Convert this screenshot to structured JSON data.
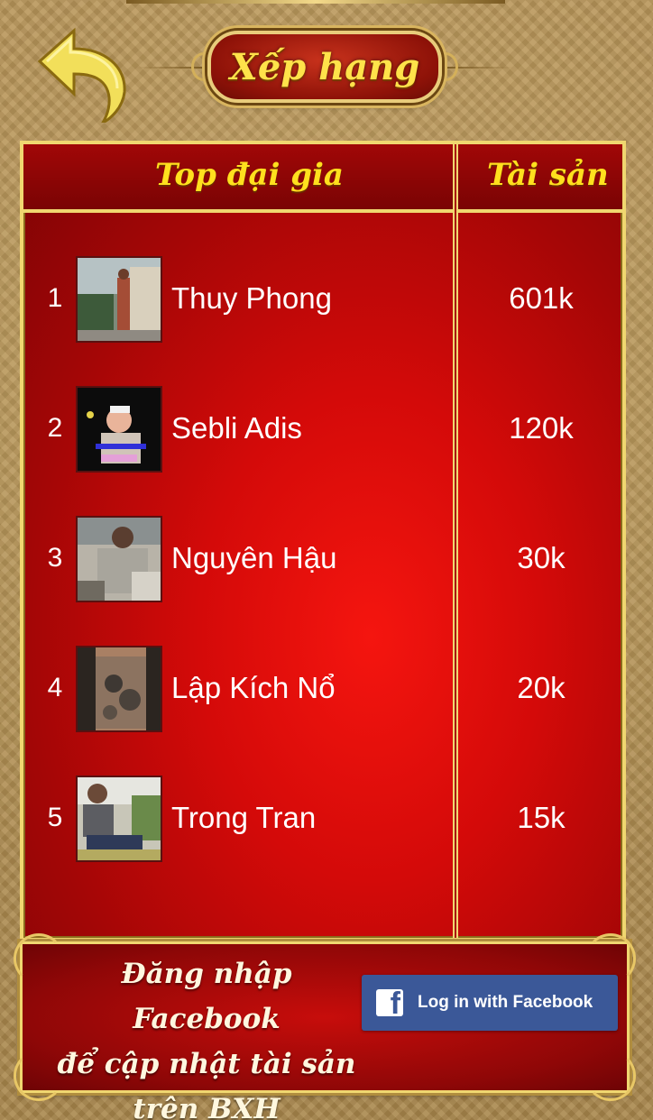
{
  "header": {
    "title": "Xếp hạng",
    "back_icon": "back-arrow-icon"
  },
  "leaderboard": {
    "column_player": "Top đại gia",
    "column_assets": "Tài sản",
    "rows": [
      {
        "rank": "1",
        "name": "Thuy Phong",
        "assets": "601k"
      },
      {
        "rank": "2",
        "name": "Sebli Adis",
        "assets": "120k"
      },
      {
        "rank": "3",
        "name": "Nguyên Hậu",
        "assets": "30k"
      },
      {
        "rank": "4",
        "name": "Lập Kích Nổ",
        "assets": "20k"
      },
      {
        "rank": "5",
        "name": "Trong Tran",
        "assets": "15k"
      }
    ]
  },
  "footer": {
    "message_line1": "Đăng nhập Facebook",
    "message_line2": "để cập nhật tài sản",
    "message_line3": "trên BXH",
    "facebook_button": "Log in with Facebook"
  },
  "colors": {
    "accent_gold": "#f0d770",
    "title_yellow": "#ffe01e",
    "board_red": "#d40a09",
    "facebook_blue": "#3b5898"
  }
}
